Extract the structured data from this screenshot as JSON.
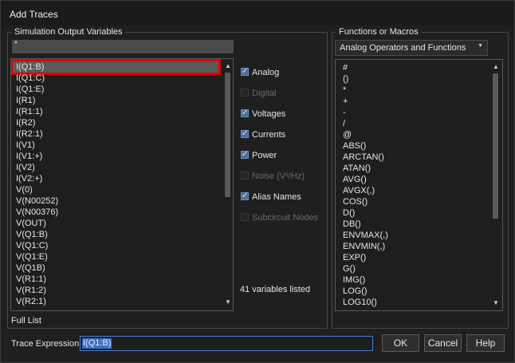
{
  "window": {
    "title": "Add Traces"
  },
  "left_panel": {
    "group_label": "Simulation Output Variables",
    "filter_value": "*",
    "variables": [
      "I(Q1:B)",
      "I(Q1:C)",
      "I(Q1:E)",
      "I(R1)",
      "I(R1:1)",
      "I(R2)",
      "I(R2:1)",
      "I(V1)",
      "I(V1:+)",
      "I(V2)",
      "I(V2:+)",
      "V(0)",
      "V(N00252)",
      "V(N00376)",
      "V(OUT)",
      "V(Q1:B)",
      "V(Q1:C)",
      "V(Q1:E)",
      "V(Q1B)",
      "V(R1:1)",
      "V(R1:2)",
      "V(R2:1)"
    ],
    "selected_index": 0,
    "footer_label": "Full List"
  },
  "filters": [
    {
      "label": "Analog",
      "checked": true,
      "enabled": true
    },
    {
      "label": "Digital",
      "checked": false,
      "enabled": false
    },
    {
      "label": "Voltages",
      "checked": true,
      "enabled": true
    },
    {
      "label": "Currents",
      "checked": true,
      "enabled": true
    },
    {
      "label": "Power",
      "checked": true,
      "enabled": true
    },
    {
      "label": "Noise (V²/Hz)",
      "checked": false,
      "enabled": false
    },
    {
      "label": "Alias Names",
      "checked": true,
      "enabled": true
    },
    {
      "label": "Subcircuit Nodes",
      "checked": false,
      "enabled": false
    }
  ],
  "variables_count_label": "41 variables listed",
  "right_panel": {
    "group_label": "Functions or Macros",
    "category_selected": "Analog Operators and Functions",
    "functions": [
      "#",
      "()",
      "*",
      "+",
      "-",
      "/",
      "@",
      "ABS()",
      "ARCTAN()",
      "ATAN()",
      "AVG()",
      "AVGX(,)",
      "COS()",
      "D()",
      "DB()",
      "ENVMAX(,)",
      "ENVMIN(,)",
      "EXP()",
      "G()",
      "IMG()",
      "LOG()",
      "LOG10()"
    ]
  },
  "bottom": {
    "trace_label": "Trace Expression:",
    "trace_value": "I(Q1:B)",
    "ok_label": "OK",
    "cancel_label": "Cancel",
    "help_label": "Help"
  },
  "colors": {
    "accent": "#4b7bd0",
    "selection_outline": "#e00000",
    "background": "#1f1f1f"
  }
}
